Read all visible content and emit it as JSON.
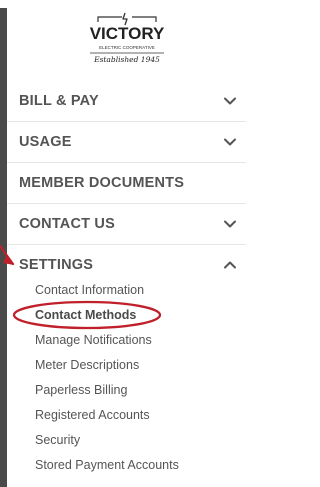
{
  "logo": {
    "name": "VICTORY",
    "tagline": "ELECTRIC COOPERATIVE",
    "established": "Established 1945"
  },
  "nav": [
    {
      "label": "BILL & PAY",
      "chevron": "down"
    },
    {
      "label": "USAGE",
      "chevron": "down"
    },
    {
      "label": "MEMBER DOCUMENTS",
      "chevron": "none"
    },
    {
      "label": "CONTACT US",
      "chevron": "down"
    },
    {
      "label": "SETTINGS",
      "chevron": "up"
    }
  ],
  "settings_items": [
    {
      "label": "Contact Information",
      "active": false
    },
    {
      "label": "Contact Methods",
      "active": true
    },
    {
      "label": "Manage Notifications",
      "active": false
    },
    {
      "label": "Meter Descriptions",
      "active": false
    },
    {
      "label": "Paperless Billing",
      "active": false
    },
    {
      "label": "Registered Accounts",
      "active": false
    },
    {
      "label": "Security",
      "active": false
    },
    {
      "label": "Stored Payment Accounts",
      "active": false
    }
  ],
  "colors": {
    "annotation": "#c0202a",
    "nav_text": "#545454",
    "backdrop": "#4a4a4a"
  }
}
